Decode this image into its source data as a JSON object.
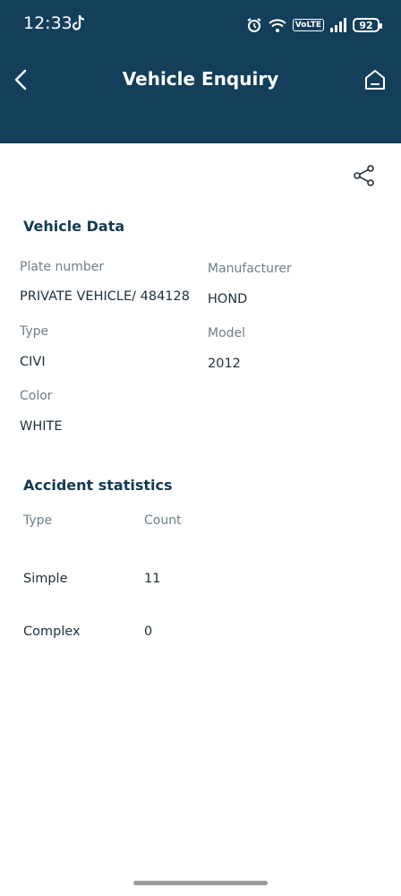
{
  "status_bar": {
    "time": "12:33",
    "battery": "92",
    "network": "VoLTE"
  },
  "header": {
    "title": "Vehicle Enquiry"
  },
  "vehicle": {
    "section_title": "Vehicle Data",
    "fields": {
      "plate": {
        "label": "Plate number",
        "value": "PRIVATE VEHICLE/ 484128"
      },
      "manufacturer": {
        "label": "Manufacturer",
        "value": "HOND"
      },
      "type": {
        "label": "Type",
        "value": "CIVI"
      },
      "model": {
        "label": "Model",
        "value": "2012"
      },
      "color": {
        "label": "Color",
        "value": "WHITE"
      }
    }
  },
  "accidents": {
    "section_title": "Accident statistics",
    "columns": [
      "Type",
      "Count"
    ],
    "rows": [
      {
        "type": "Simple",
        "count": "11"
      },
      {
        "type": "Complex",
        "count": "0"
      }
    ]
  }
}
